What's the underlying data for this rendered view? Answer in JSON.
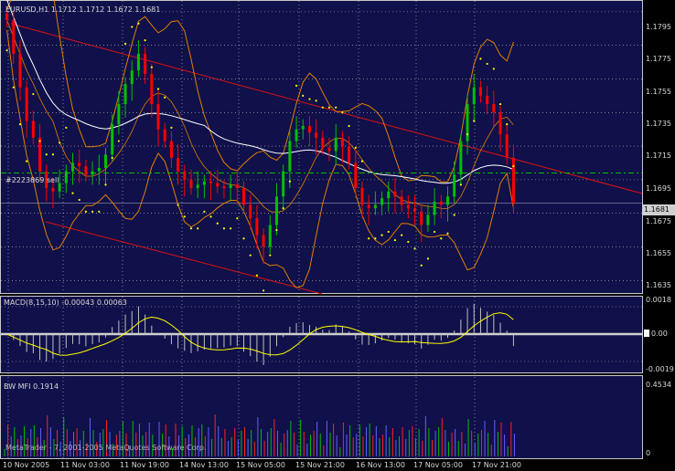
{
  "window": {
    "symbol_header": "EURUSD,H1  1.1712 1.1712 1.1672 1.1681",
    "copyright": "MetaTrader - 7, 2001-2005 MetaQuotes Software Corp."
  },
  "colors": {
    "background": "#000000",
    "pane": "#10104a",
    "grid": "#c8c8c8",
    "bull": "#00c000",
    "bear": "#ff0000",
    "bands": "#e08000",
    "ma": "#ffffff",
    "sar": "#ffff00",
    "channel": "#e01010",
    "order_line": "#00c000",
    "macd_signal": "#ffff00",
    "macd_hist": "#c0c0c0"
  },
  "main_panel": {
    "order_label": "#2223869 sell",
    "current_price": "1.1681",
    "price_axis": [
      "1.1795",
      "1.1775",
      "1.1755",
      "1.1735",
      "1.1715",
      "1.1695",
      "1.1675",
      "1.1655",
      "1.1635"
    ]
  },
  "macd_panel": {
    "label": "MACD(8,15,10) -0.00043 0.00063",
    "axis": [
      "0.0018",
      "0.00",
      "-0.0019"
    ]
  },
  "mfi_panel": {
    "label": "BW MFI 0.1914",
    "axis": [
      "0.4534",
      "0"
    ]
  },
  "time_axis": [
    "10 Nov 2005",
    "11 Nov 03:00",
    "11 Nov 19:00",
    "14 Nov 13:00",
    "15 Nov 05:00",
    "15 Nov 21:00",
    "16 Nov 13:00",
    "17 Nov 05:00",
    "17 Nov 21:00"
  ],
  "chart_data": {
    "type": "candlestick",
    "symbol": "EURUSD",
    "timeframe": "H1",
    "ohlc_header": {
      "open": 1.1712,
      "high": 1.1712,
      "low": 1.1672,
      "close": 1.1681
    },
    "ylim": [
      1.1627,
      1.1802
    ],
    "order_sell_price": 1.1699,
    "closes": [
      1.179,
      1.177,
      1.175,
      1.173,
      1.172,
      1.17,
      1.169,
      1.1688,
      1.1693,
      1.17,
      1.1705,
      1.1703,
      1.1698,
      1.17,
      1.1702,
      1.171,
      1.1728,
      1.174,
      1.1752,
      1.176,
      1.177,
      1.1758,
      1.174,
      1.1725,
      1.1718,
      1.1708,
      1.17,
      1.1695,
      1.169,
      1.1692,
      1.1694,
      1.1693,
      1.1691,
      1.169,
      1.1692,
      1.169,
      1.168,
      1.1672,
      1.1662,
      1.1655,
      1.1668,
      1.1685,
      1.17,
      1.1718,
      1.1725,
      1.1727,
      1.1723,
      1.172,
      1.1714,
      1.1712,
      1.172,
      1.1715,
      1.1705,
      1.169,
      1.168,
      1.1678,
      1.168,
      1.1684,
      1.1688,
      1.1685,
      1.168,
      1.1678,
      1.1676,
      1.1668,
      1.1674,
      1.1682,
      1.168,
      1.1685,
      1.1698,
      1.1718,
      1.174,
      1.175,
      1.1745,
      1.174,
      1.1735,
      1.1722,
      1.1708,
      1.1681
    ]
  }
}
